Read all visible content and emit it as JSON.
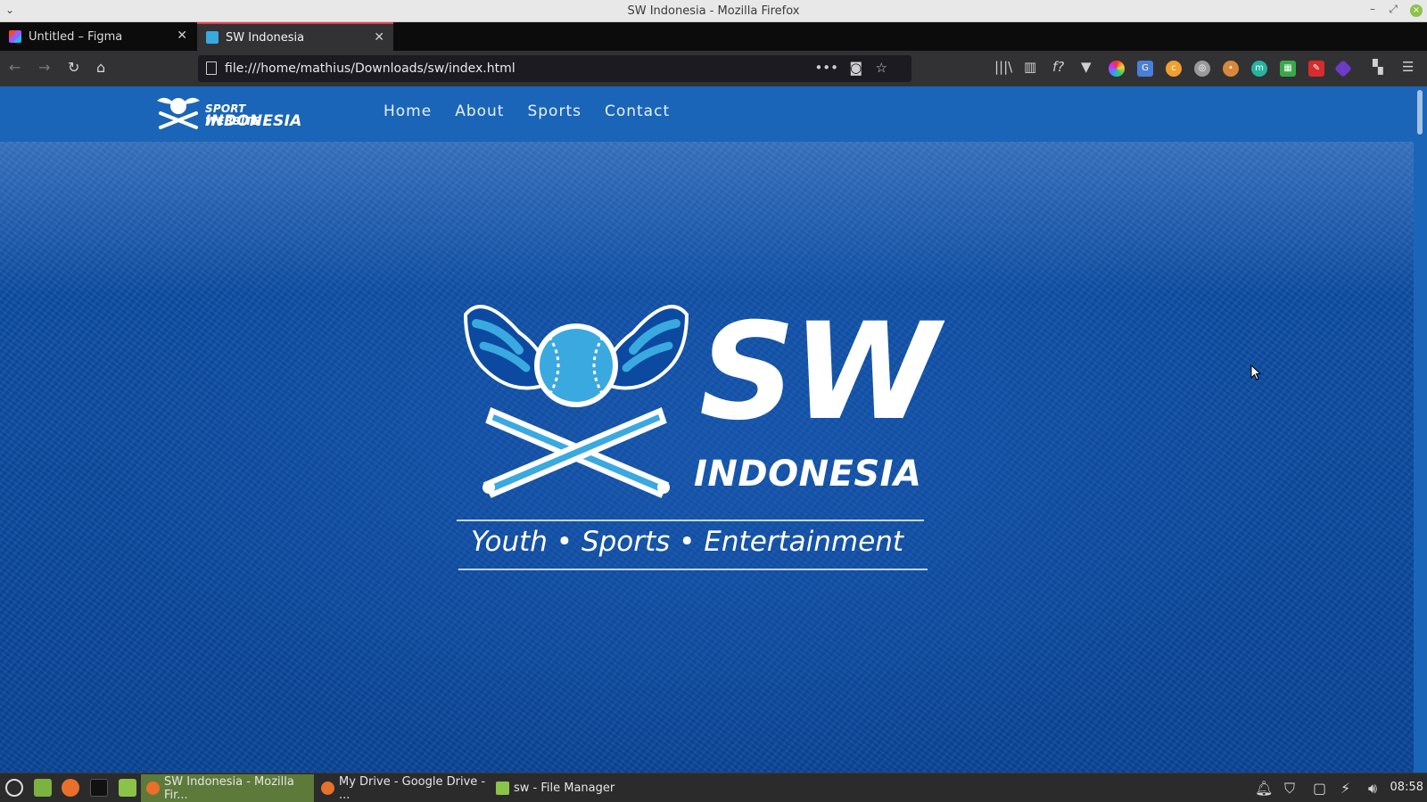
{
  "window": {
    "title": "SW Indonesia - Mozilla Firefox",
    "menu_icon": "chevron-down-icon",
    "controls": [
      "minimize-icon",
      "restore-icon",
      "close-icon"
    ]
  },
  "tabs": [
    {
      "label": "Untitled – Figma",
      "icon": "figma-icon",
      "active": false
    },
    {
      "label": "SW Indonesia",
      "icon": "sw-favicon",
      "active": true
    }
  ],
  "navbar": {
    "url": "file:///home/mathius/Downloads/sw/index.html",
    "buttons": [
      "back-icon",
      "forward-icon",
      "reload-icon",
      "home-icon"
    ],
    "url_actions": [
      "page-actions-icon",
      "pocket-icon",
      "bookmark-star-icon"
    ],
    "extensions": [
      "library-icon",
      "sidebar-icon",
      "fonts-icon",
      "vue-devtools-icon",
      "color-picker-icon",
      "translate-icon",
      "extension-icon",
      "globe-icon",
      "cookie-icon",
      "m-extension-icon",
      "sheets-icon",
      "pen-icon",
      "gem-icon",
      "extensions-puzzle-icon",
      "hamburger-menu-icon"
    ]
  },
  "site": {
    "logo_line1": "SPORT WEBSITE",
    "logo_line2": "INDONESIA",
    "nav": [
      "Home",
      "About",
      "Sports",
      "Contact"
    ],
    "hero_sw": "SW",
    "hero_indonesia": "INDONESIA",
    "tagline": "Youth • Sports • Entertainment",
    "colors": {
      "header": "#1a65b8",
      "overlay": "#0b4fa8",
      "accent": "#3aa9e0"
    }
  },
  "taskbar": {
    "launchers": [
      "menu-icon",
      "files-icon",
      "firefox-icon",
      "terminal-icon",
      "folder-icon"
    ],
    "items": [
      {
        "label": "SW Indonesia - Mozilla Fir...",
        "icon": "firefox-icon",
        "active": true
      },
      {
        "label": "My Drive - Google Drive - ...",
        "icon": "firefox-icon",
        "active": false
      },
      {
        "label": "sw - File Manager",
        "icon": "folder-icon",
        "active": false
      }
    ],
    "tray": [
      "notification-bell-icon",
      "shield-icon",
      "window-icon",
      "power-icon",
      "volume-icon"
    ],
    "clock": "08:58"
  }
}
